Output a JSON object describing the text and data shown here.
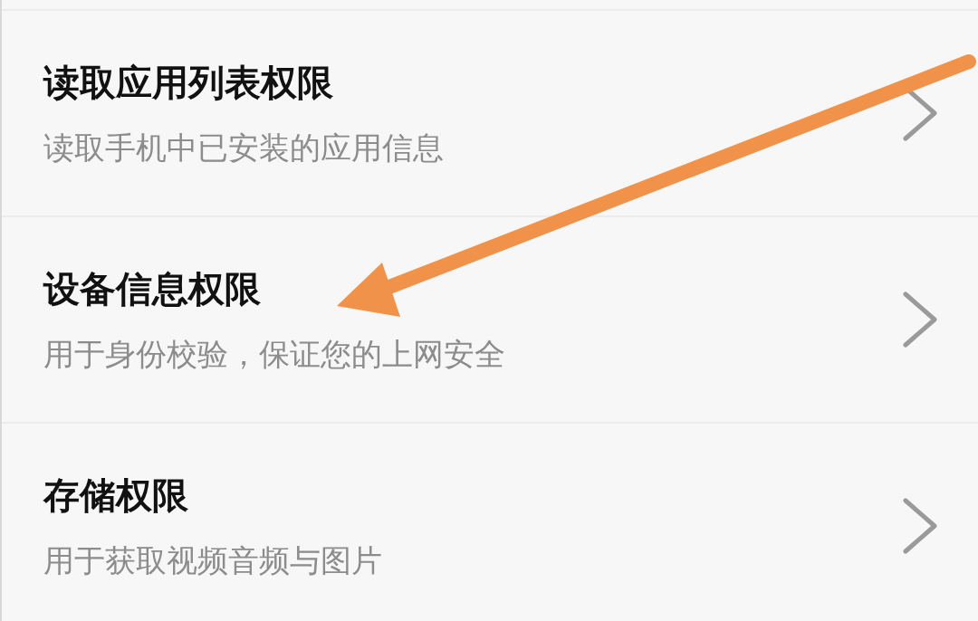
{
  "permissions": [
    {
      "title": "读取应用列表权限",
      "description": "读取手机中已安装的应用信息"
    },
    {
      "title": "设备信息权限",
      "description": "用于身份校验，保证您的上网安全"
    },
    {
      "title": "存储权限",
      "description": "用于获取视频音频与图片"
    }
  ]
}
